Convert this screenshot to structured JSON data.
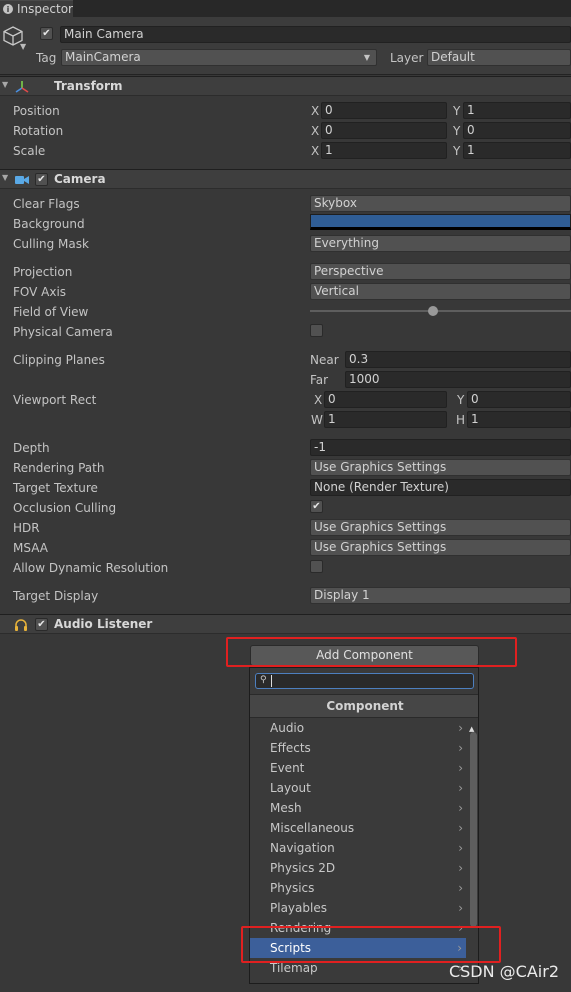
{
  "tab": {
    "label": "Inspector"
  },
  "object": {
    "name": "Main Camera",
    "tag_label": "Tag",
    "tag_value": "MainCamera",
    "layer_label": "Layer",
    "layer_value": "Default",
    "active": true
  },
  "transform": {
    "title": "Transform",
    "rows": [
      {
        "label": "Position",
        "x": "0",
        "y": "1"
      },
      {
        "label": "Rotation",
        "x": "0",
        "y": "0"
      },
      {
        "label": "Scale",
        "x": "1",
        "y": "1"
      }
    ],
    "axis_x": "X",
    "axis_y": "Y"
  },
  "camera": {
    "title": "Camera",
    "clear_flags": {
      "label": "Clear Flags",
      "value": "Skybox"
    },
    "background": {
      "label": "Background",
      "color": "#2f5d95"
    },
    "culling_mask": {
      "label": "Culling Mask",
      "value": "Everything"
    },
    "projection": {
      "label": "Projection",
      "value": "Perspective"
    },
    "fov_axis": {
      "label": "FOV Axis",
      "value": "Vertical"
    },
    "field_of_view": {
      "label": "Field of View",
      "level": 0.47
    },
    "physical_camera": {
      "label": "Physical Camera",
      "checked": false
    },
    "clipping": {
      "label": "Clipping Planes",
      "near_label": "Near",
      "near": "0.3",
      "far_label": "Far",
      "far": "1000"
    },
    "viewport": {
      "label": "Viewport Rect",
      "x_label": "X",
      "x": "0",
      "y_label": "Y",
      "y": "0",
      "w_label": "W",
      "w": "1",
      "h_label": "H",
      "h": "1"
    },
    "depth": {
      "label": "Depth",
      "value": "-1"
    },
    "rendering_path": {
      "label": "Rendering Path",
      "value": "Use Graphics Settings"
    },
    "target_texture": {
      "label": "Target Texture",
      "value": "None (Render Texture)"
    },
    "occlusion_culling": {
      "label": "Occlusion Culling",
      "checked": true
    },
    "hdr": {
      "label": "HDR",
      "value": "Use Graphics Settings"
    },
    "msaa": {
      "label": "MSAA",
      "value": "Use Graphics Settings"
    },
    "dynamic_resolution": {
      "label": "Allow Dynamic Resolution",
      "checked": false
    },
    "target_display": {
      "label": "Target Display",
      "value": "Display 1"
    }
  },
  "audio_listener": {
    "title": "Audio Listener"
  },
  "add_component": {
    "button_label": "Add Component",
    "search_value": "",
    "header": "Component",
    "items": [
      "Audio",
      "Effects",
      "Event",
      "Layout",
      "Mesh",
      "Miscellaneous",
      "Navigation",
      "Physics 2D",
      "Physics",
      "Playables",
      "Rendering",
      "Scripts",
      "Tilemap"
    ],
    "selected": "Scripts"
  },
  "watermark": "CSDN @CAir2",
  "colors": {
    "highlight": "#e02020",
    "selection": "#3c5f9a"
  }
}
